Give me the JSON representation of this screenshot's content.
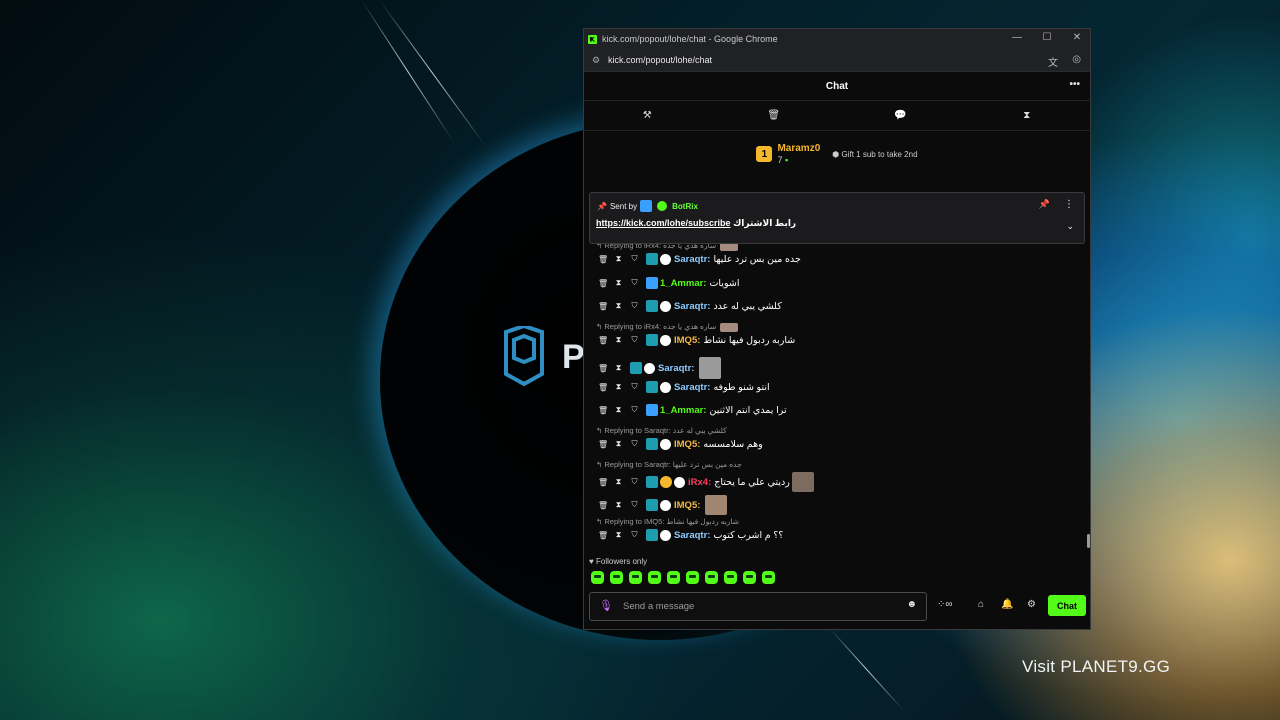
{
  "desktop": {
    "logo_letter": "P",
    "visit_text": "Visit PLANET9.GG"
  },
  "browser": {
    "title": "kick.com/popout/lohe/chat - Google Chrome",
    "url": "kick.com/popout/lohe/chat",
    "controls": {
      "minimize": "—",
      "maximize": "☐",
      "close": "✕"
    }
  },
  "chat": {
    "header_title": "Chat",
    "header_more": "•••",
    "tools": [
      "⚒",
      "🗑",
      "💬",
      "⧗"
    ],
    "leaderboard": {
      "rank": "1",
      "name": "Maramz0",
      "count": "7",
      "gift_text": "Gift 1 sub to take 2nd"
    },
    "pinned": {
      "sent_by": "Sent by",
      "sender": "BotRix",
      "link": "https://kick.com/lohe/subscribe",
      "link_text": "رابط الاشتراك"
    },
    "messages": [
      {
        "reply": "Replying to iRx4: ساره هدي يا جده",
        "user": "Saraqtr:",
        "color": "#8ecbff",
        "text": "جده مين بس ترد عليها"
      },
      {
        "user": "1_Ammar:",
        "color": "#53fc18",
        "text": "اشويات"
      },
      {
        "user": "Saraqtr:",
        "color": "#8ecbff",
        "text": "كلشي يبي له عدد"
      },
      {
        "reply": "Replying to iRx4: ساره هدي يا جده",
        "user": "IMQ5:",
        "color": "#f0b840",
        "text": "شاربه ردبول فيها نشاط"
      },
      {
        "user": "Saraqtr:",
        "color": "#8ecbff",
        "text": ""
      },
      {
        "user": "Saraqtr:",
        "color": "#8ecbff",
        "text": "انتو شنو طوفه"
      },
      {
        "user": "1_Ammar:",
        "color": "#53fc18",
        "text": "ترا يمدي انتم الاثنين"
      },
      {
        "reply": "Replying to Saraqtr: كلشي يبي له عدد",
        "user": "IMQ5:",
        "color": "#f0b840",
        "text": "وهم سلامسسه"
      },
      {
        "reply": "Replying to Saraqtr: جده مين بس ترد عليها",
        "user": "iRx4:",
        "color": "#ff3b5c",
        "text": "رديتي علي ما يحتاج"
      },
      {
        "user": "IMQ5:",
        "color": "#f0b840",
        "text": ""
      },
      {
        "reply": "Replying to IMQ5: شاربه ردبول فيها نشاط",
        "user": "Saraqtr:",
        "color": "#8ecbff",
        "text": "؟؟ م اشرب كتوب"
      }
    ],
    "followers_only": "Followers only",
    "input_placeholder": "Send a message",
    "send_label": "Chat",
    "accent": "#53fc18"
  }
}
